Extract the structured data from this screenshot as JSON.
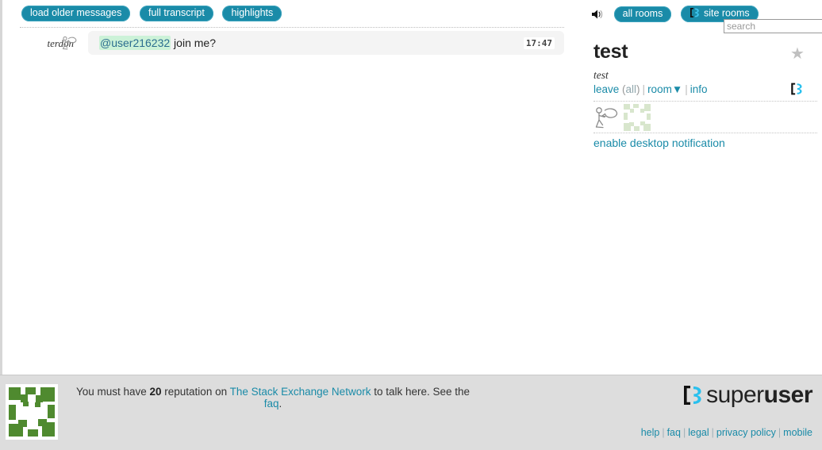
{
  "chat_toolbar": {
    "buttons": [
      {
        "label": "load older messages",
        "name": "load-older-messages-button"
      },
      {
        "label": "full transcript",
        "name": "full-transcript-button"
      },
      {
        "label": "highlights",
        "name": "highlights-button"
      }
    ]
  },
  "messages": [
    {
      "user": "terdon",
      "mention": "@user216232",
      "text": " join me?",
      "time": "17:47"
    }
  ],
  "sidebar": {
    "rooms_nav": {
      "speaker_icon": "speaker-icon",
      "all_rooms_label": "all rooms",
      "site_rooms_label": "site rooms"
    },
    "search": {
      "placeholder": "search",
      "value": ""
    },
    "room": {
      "title": "test",
      "description": "test",
      "star_icon": "★",
      "controls": {
        "leave": "leave",
        "all": "all",
        "room": "room",
        "room_caret": "▼",
        "info": "info"
      }
    },
    "users": [
      {
        "name": "user-avatar-terdon"
      },
      {
        "name": "user-avatar-user216232"
      }
    ],
    "notification_link": "enable desktop notification"
  },
  "footer": {
    "message": {
      "prefix": "You must have ",
      "reputation": "20",
      "middle": " reputation on ",
      "network_link": "The Stack Exchange Network",
      "suffix": " to talk here. See the ",
      "faq_link": "faq",
      "period": "."
    },
    "logo": {
      "light": "super",
      "bold": "user"
    },
    "links": [
      {
        "label": "help",
        "name": "footer-link-help"
      },
      {
        "label": "faq",
        "name": "footer-link-faq"
      },
      {
        "label": "legal",
        "name": "footer-link-legal"
      },
      {
        "label": "privacy policy",
        "name": "footer-link-privacy-policy"
      },
      {
        "label": "mobile",
        "name": "footer-link-mobile"
      }
    ],
    "separator": "|"
  },
  "colors": {
    "accent_teal": "#1a8ba8",
    "mention_highlight": "#ccf2d8",
    "footer_bg": "#dddddd",
    "identicon_green": "#4f8a2f"
  }
}
